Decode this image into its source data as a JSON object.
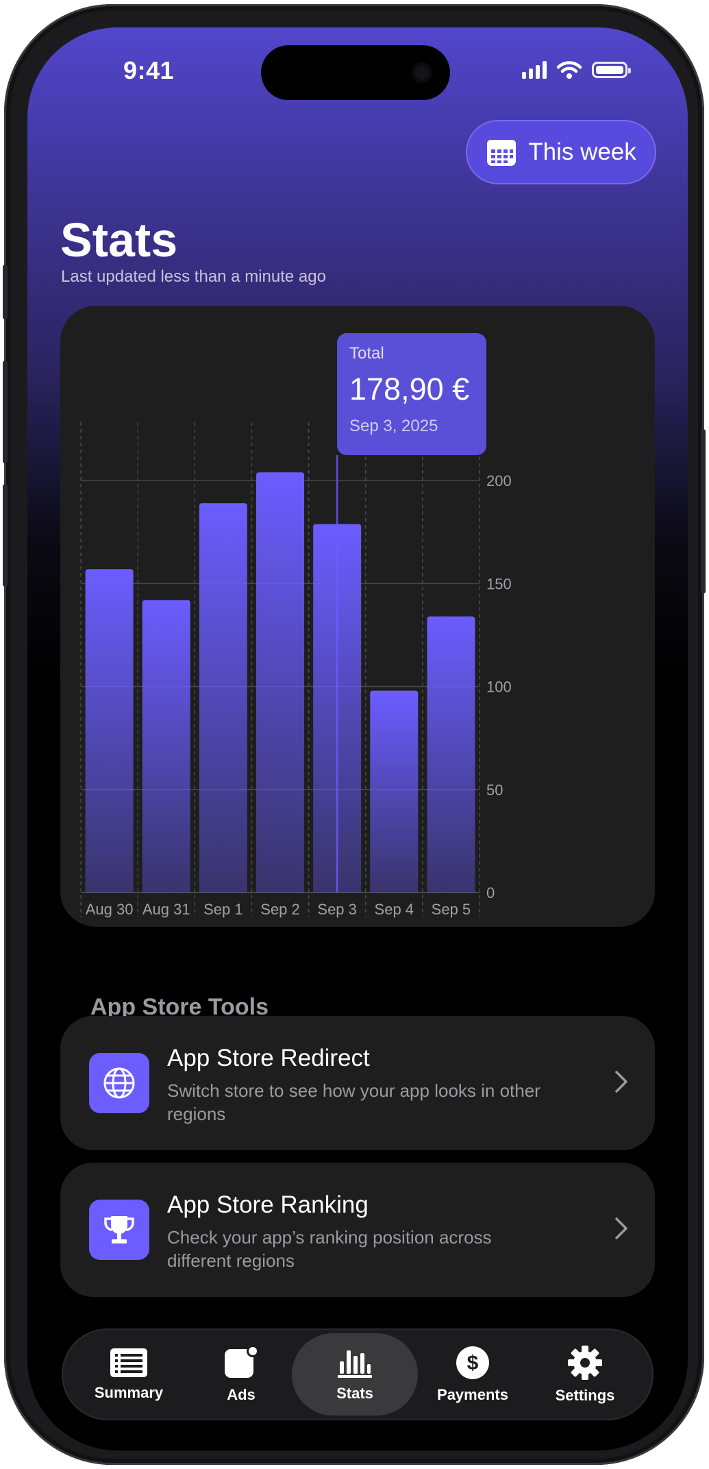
{
  "status_bar": {
    "time": "9:41"
  },
  "header": {
    "period_button": "This week",
    "title": "Stats",
    "subtitle": "Last updated less than a minute ago"
  },
  "tooltip": {
    "label": "Total",
    "value": "178,90 €",
    "date": "Sep 3, 2025"
  },
  "chart_data": {
    "type": "bar",
    "categories": [
      "Aug 30",
      "Aug 31",
      "Sep 1",
      "Sep 2",
      "Sep 3",
      "Sep 4",
      "Sep 5"
    ],
    "values": [
      157,
      142,
      189,
      204,
      178.9,
      98,
      134
    ],
    "y_ticks": [
      0,
      50,
      100,
      150,
      200
    ],
    "ylim": [
      0,
      225
    ],
    "highlight_index": 4,
    "grid": true,
    "bar_color": "#6b5dff"
  },
  "tools": {
    "section_title": "App Store Tools",
    "items": [
      {
        "title": "App Store Redirect",
        "description": "Switch store to see how your app looks in other regions",
        "icon": "globe-icon"
      },
      {
        "title": "App Store Ranking",
        "description": "Check your app’s ranking position across different regions",
        "icon": "trophy-icon"
      }
    ]
  },
  "tabbar": {
    "active": "Stats",
    "items": [
      {
        "label": "Summary",
        "icon": "list-icon"
      },
      {
        "label": "Ads",
        "icon": "ads-icon"
      },
      {
        "label": "Stats",
        "icon": "bar-chart-icon"
      },
      {
        "label": "Payments",
        "icon": "dollar-icon"
      },
      {
        "label": "Settings",
        "icon": "gear-icon"
      }
    ]
  },
  "colors": {
    "accent": "#6b5dff",
    "card": "#1e1e1e",
    "tooltip": "#5a50d8"
  }
}
